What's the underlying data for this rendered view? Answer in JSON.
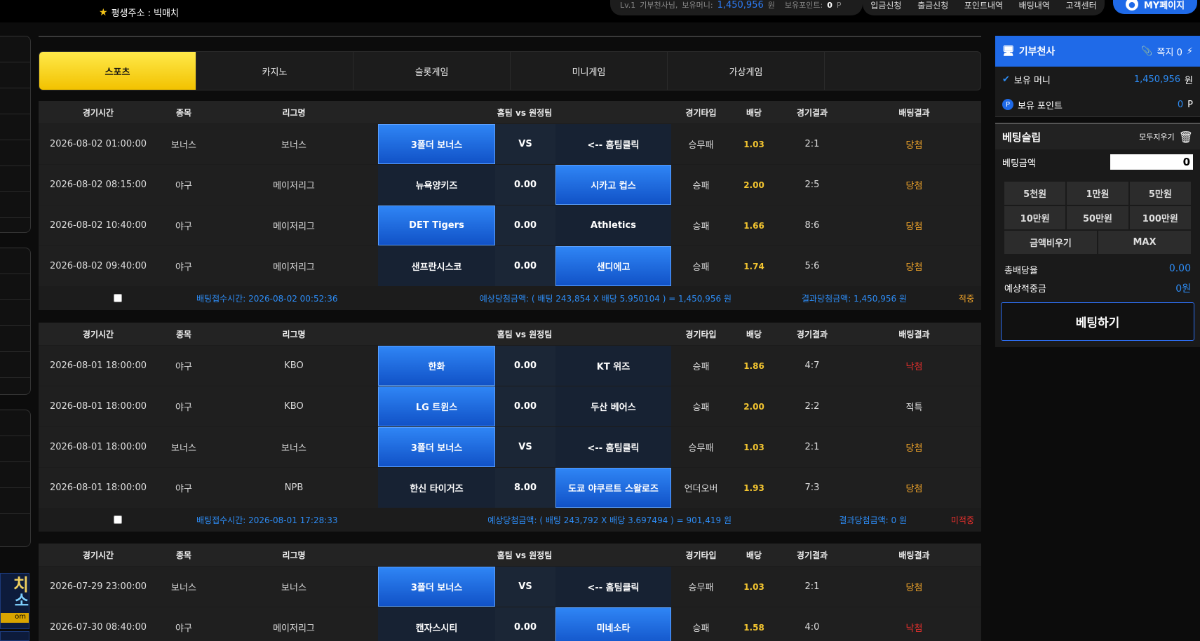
{
  "top": {
    "address_label": "평생주소 : 빅매치",
    "level": "Lv.1",
    "username": "기부천사님,",
    "money_label": "보유머니:",
    "money_value": "1,450,956",
    "money_unit": "원",
    "points_label": "보유포인트:",
    "points_value": "0",
    "points_unit": "P",
    "menus": [
      "입금신청",
      "출금신청",
      "포인트내역",
      "배팅내역",
      "고객센터"
    ],
    "mypage": "MY페이지"
  },
  "tabs": [
    "스포츠",
    "카지노",
    "슬롯게임",
    "미니게임",
    "가상게임"
  ],
  "headers": [
    "경기시간",
    "종목",
    "리그명",
    "홈팀 vs 원정팀",
    "경기타입",
    "배당",
    "경기결과",
    "배팅결과"
  ],
  "blocks": [
    {
      "rows": [
        {
          "time": "2026-08-02 01:00:00",
          "sport": "보너스",
          "league": "보너스",
          "home": "3폴더 보너스",
          "mid": "VS",
          "away": "<-- 홈팀클릭",
          "type": "승무패",
          "odds": "1.03",
          "score": "2:1",
          "result": "당첨",
          "pick": "home"
        },
        {
          "time": "2026-08-02 08:15:00",
          "sport": "야구",
          "league": "메이저리그",
          "home": "뉴욕양키즈",
          "mid": "0.00",
          "away": "시카고 컵스",
          "type": "승패",
          "odds": "2.00",
          "score": "2:5",
          "result": "당첨",
          "pick": "away"
        },
        {
          "time": "2026-08-02 10:40:00",
          "sport": "야구",
          "league": "메이저리그",
          "home": "DET Tigers",
          "mid": "0.00",
          "away": "Athletics",
          "type": "승패",
          "odds": "1.66",
          "score": "8:6",
          "result": "당첨",
          "pick": "home"
        },
        {
          "time": "2026-08-02 09:40:00",
          "sport": "야구",
          "league": "메이저리그",
          "home": "샌프란시스코",
          "mid": "0.00",
          "away": "샌디에고",
          "type": "승패",
          "odds": "1.74",
          "score": "5:6",
          "result": "당첨",
          "pick": "away"
        }
      ],
      "footer": {
        "time": "배팅접수시간: 2026-08-02 00:52:36",
        "expect": "예상당첨금액: ( 배팅 243,854 X 배당 5.950104 ) = 1,450,956 원",
        "result": "결과당첨금액: 1,450,956 원",
        "status": "적중"
      }
    },
    {
      "rows": [
        {
          "time": "2026-08-01 18:00:00",
          "sport": "야구",
          "league": "KBO",
          "home": "한화",
          "mid": "0.00",
          "away": "KT 위즈",
          "type": "승패",
          "odds": "1.86",
          "score": "4:7",
          "result": "낙첨",
          "pick": "home"
        },
        {
          "time": "2026-08-01 18:00:00",
          "sport": "야구",
          "league": "KBO",
          "home": "LG 트윈스",
          "mid": "0.00",
          "away": "두산 베어스",
          "type": "승패",
          "odds": "2.00",
          "score": "2:2",
          "result": "적특",
          "pick": "home"
        },
        {
          "time": "2026-08-01 18:00:00",
          "sport": "보너스",
          "league": "보너스",
          "home": "3폴더 보너스",
          "mid": "VS",
          "away": "<-- 홈팀클릭",
          "type": "승무패",
          "odds": "1.03",
          "score": "2:1",
          "result": "당첨",
          "pick": "home"
        },
        {
          "time": "2026-08-01 18:00:00",
          "sport": "야구",
          "league": "NPB",
          "home": "한신 타이거즈",
          "mid": "8.00",
          "away": "도쿄 야쿠르트 스왈로즈",
          "type": "언더오버",
          "odds": "1.93",
          "score": "7:3",
          "result": "당첨",
          "pick": "away"
        }
      ],
      "footer": {
        "time": "배팅접수시간: 2026-08-01 17:28:33",
        "expect": "예상당첨금액: ( 배팅 243,792 X 배당 3.697494 ) = 901,419 원",
        "result": "결과당첨금액: 0 원",
        "status": "미적중"
      }
    },
    {
      "rows": [
        {
          "time": "2026-07-29 23:00:00",
          "sport": "보너스",
          "league": "보너스",
          "home": "3폴더 보너스",
          "mid": "VS",
          "away": "<-- 홈팀클릭",
          "type": "승무패",
          "odds": "1.03",
          "score": "2:1",
          "result": "당첨",
          "pick": "home"
        },
        {
          "time": "2026-07-30 08:40:00",
          "sport": "야구",
          "league": "메이저리그",
          "home": "캔자스시티",
          "mid": "0.00",
          "away": "미네소타",
          "type": "승패",
          "odds": "1.58",
          "score": "4:0",
          "result": "낙첨",
          "pick": "away"
        }
      ]
    }
  ],
  "right": {
    "user": "기부천사",
    "slip_label": "쪽지 0",
    "money_label": "보유 머니",
    "money_value": "1,450,956",
    "money_unit": "원",
    "points_label": "보유 포인트",
    "points_value": "0",
    "points_unit": "P",
    "slip_title": "베팅슬립",
    "clear_all": "모두지우기",
    "amount_label": "베팅금액",
    "amount_value": "0",
    "chips": [
      "5천원",
      "1만원",
      "5만원",
      "10만원",
      "50만원",
      "100만원"
    ],
    "chips2": [
      "금액비우기",
      "MAX"
    ],
    "total_odds_label": "총배당율",
    "total_odds_value": "0.00",
    "expected_label": "예상적중금",
    "expected_value": "0원",
    "bet_button": "베팅하기"
  },
  "left_banner": {
    "line1": "치",
    "line2": "소",
    "line3": "om"
  }
}
